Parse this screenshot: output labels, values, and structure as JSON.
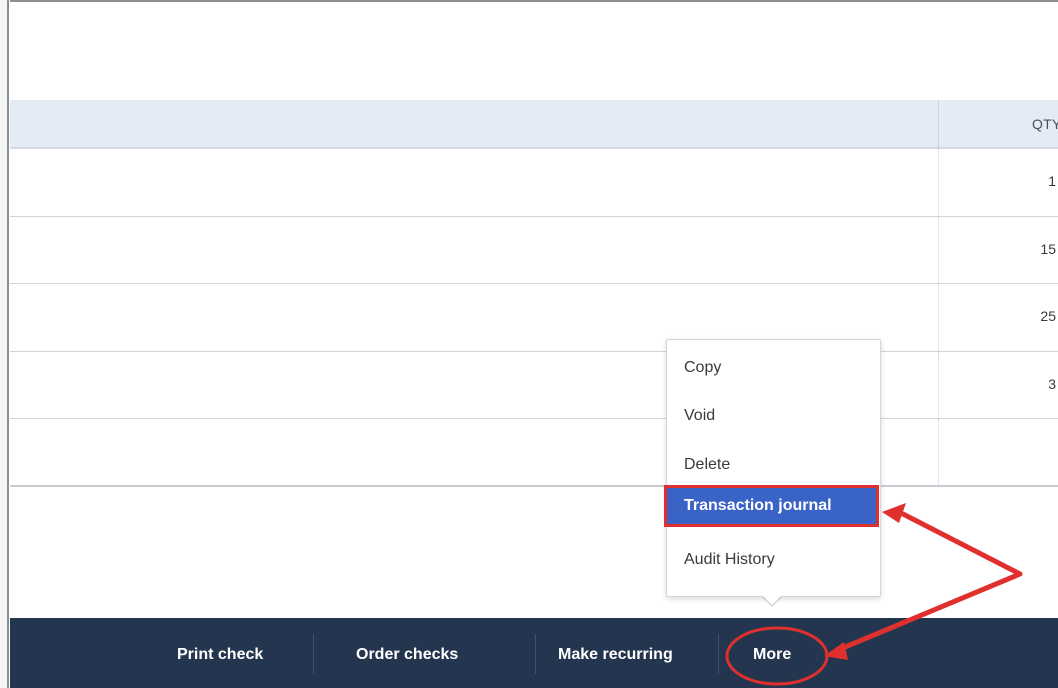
{
  "table": {
    "header_qty": "QTY",
    "rows": [
      {
        "qty": "1"
      },
      {
        "qty": "15"
      },
      {
        "qty": "25"
      },
      {
        "qty": "3"
      },
      {
        "qty": ""
      }
    ]
  },
  "menu": {
    "items": [
      {
        "label": "Copy"
      },
      {
        "label": "Void"
      },
      {
        "label": "Delete"
      },
      {
        "label": "Transaction journal"
      },
      {
        "label": "Audit History"
      }
    ]
  },
  "footer": {
    "print_check": "Print check",
    "order_checks": "Order checks",
    "make_recurring": "Make recurring",
    "more": "More"
  },
  "colors": {
    "footer_bg": "#24364f",
    "header_bg": "#e3ebf5",
    "menu_highlight": "#3a63c7",
    "annotation_red": "#e0302e"
  }
}
